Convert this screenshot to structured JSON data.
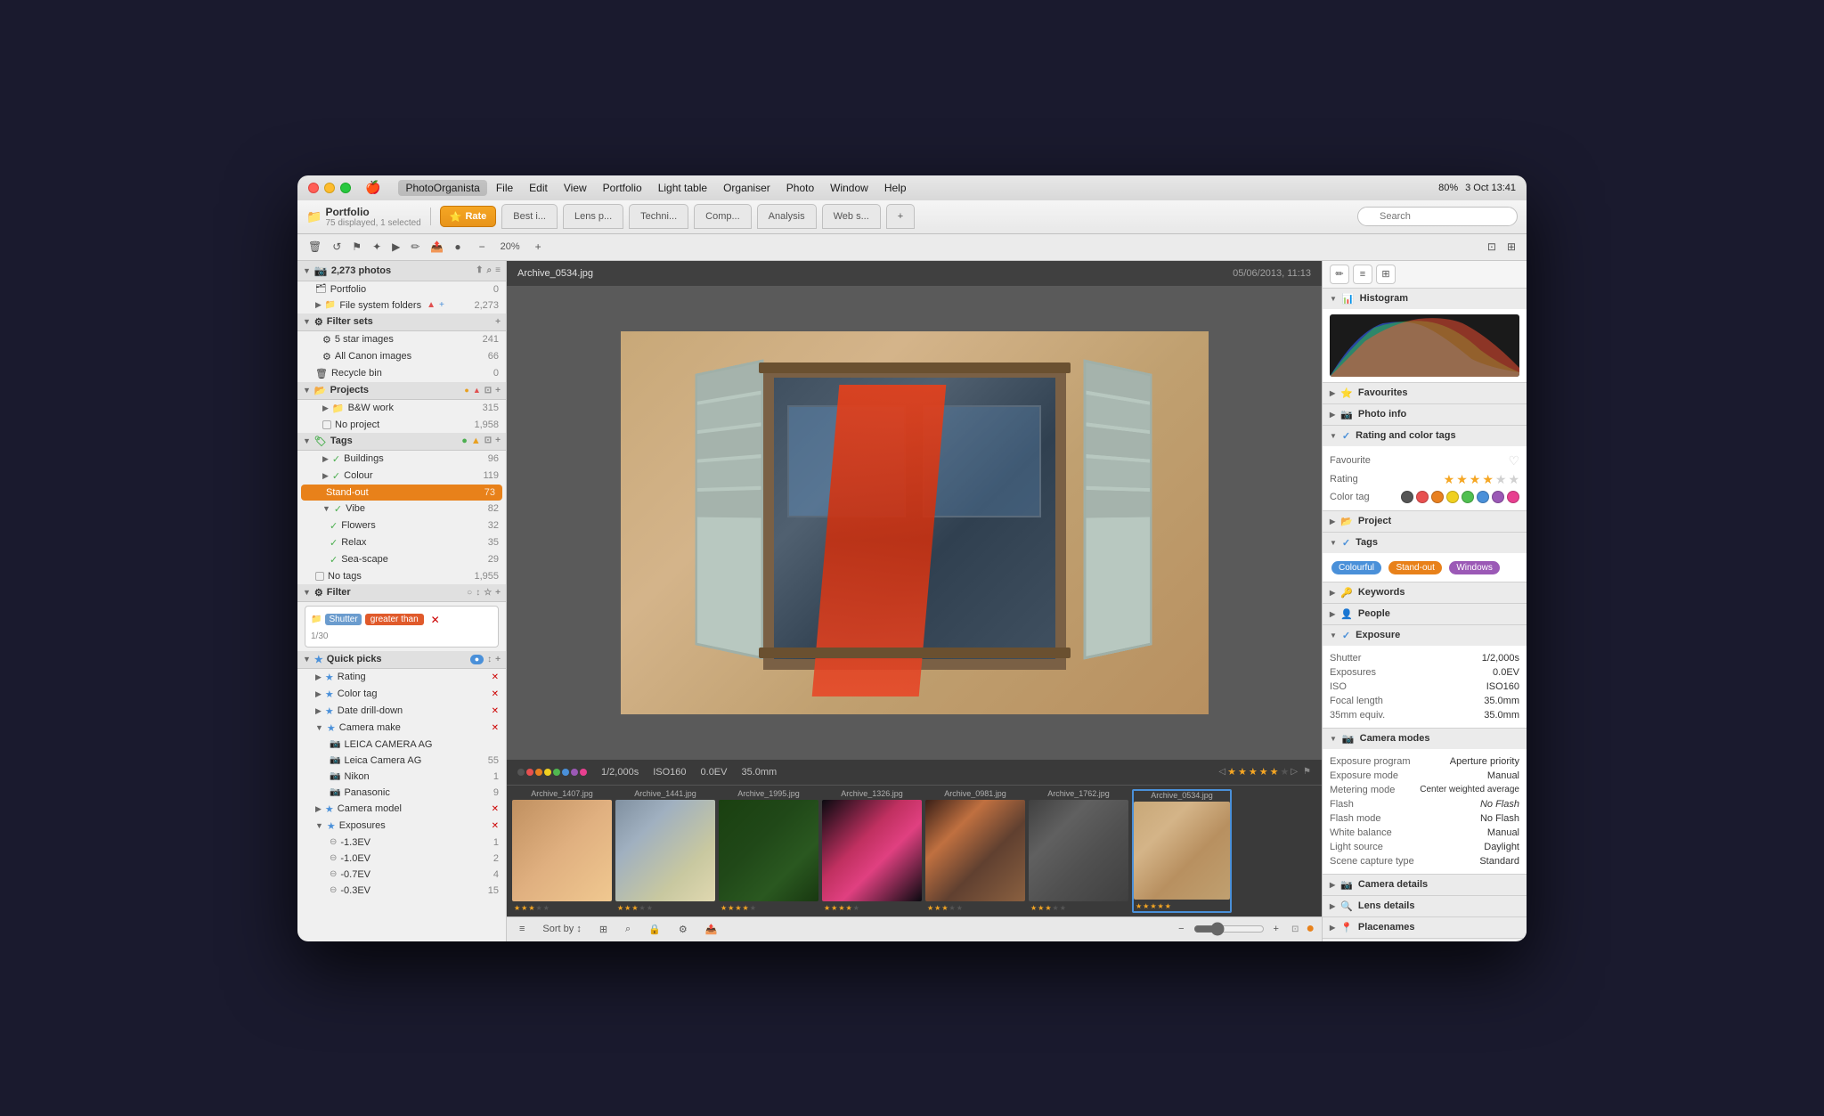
{
  "app": {
    "name": "PhotoOrganista",
    "date": "3 Oct",
    "time": "13:41",
    "battery": "80%"
  },
  "menu": {
    "apple": "🍎",
    "items": [
      "PhotoOrganista",
      "File",
      "Edit",
      "View",
      "Portfolio",
      "Light table",
      "Organiser",
      "Photo",
      "Window",
      "Help"
    ]
  },
  "toolbar": {
    "portfolio_label": "Portfolio",
    "portfolio_subtitle": "75 displayed, 1 selected",
    "tabs": [
      {
        "label": "Rate",
        "active": true,
        "icon": "⭐"
      },
      {
        "label": "Best i...",
        "active": false
      },
      {
        "label": "Lens p...",
        "active": false
      },
      {
        "label": "Techni...",
        "active": false
      },
      {
        "label": "Comp...",
        "active": false
      },
      {
        "label": "Analysis",
        "active": false
      },
      {
        "label": "Web s...",
        "active": false
      }
    ],
    "zoom_percent": "20%",
    "search_placeholder": "Search"
  },
  "sidebar": {
    "photos_count": "2,273 photos",
    "portfolio": {
      "label": "Portfolio",
      "count": "0"
    },
    "file_system": {
      "label": "File system folders",
      "count": "2,273"
    },
    "filter_sets": {
      "label": "Filter sets",
      "items": [
        {
          "label": "5 star images",
          "count": "241"
        },
        {
          "label": "All Canon images",
          "count": "66"
        }
      ]
    },
    "recycle_bin": {
      "label": "Recycle bin",
      "count": "0"
    },
    "projects": {
      "label": "Projects",
      "items": [
        {
          "label": "B&W work",
          "count": "315"
        },
        {
          "label": "No project",
          "count": "1,958"
        }
      ]
    },
    "tags": {
      "label": "Tags",
      "items": [
        {
          "label": "Buildings",
          "count": "96"
        },
        {
          "label": "Colour",
          "count": "119"
        },
        {
          "label": "Stand-out",
          "count": "73",
          "active": true
        },
        {
          "label": "Vibe",
          "count": "82"
        },
        {
          "label": "Flowers",
          "count": "32"
        },
        {
          "label": "Relax",
          "count": "35"
        },
        {
          "label": "Sea-scape",
          "count": "29"
        },
        {
          "label": "No tags",
          "count": "1,955"
        }
      ]
    },
    "filter": {
      "label": "Filter",
      "type": "Shutter",
      "condition": "greater than",
      "value": "1/30"
    },
    "quick_picks": {
      "label": "Quick picks",
      "items": [
        "Rating",
        "Color tag",
        "Date drill-down",
        "Camera make",
        "Camera model",
        "Exposures"
      ],
      "camera_makes": [
        {
          "label": "LEICA CAMERA AG",
          "count": ""
        },
        {
          "label": "Leica Camera AG",
          "count": "55"
        },
        {
          "label": "Nikon",
          "count": "1"
        },
        {
          "label": "Panasonic",
          "count": "9"
        }
      ]
    },
    "exposures": [
      {
        "label": "-1.3EV",
        "count": "1"
      },
      {
        "label": "-1.0EV",
        "count": "2"
      },
      {
        "label": "-0.7EV",
        "count": "4"
      },
      {
        "label": "-0.3EV",
        "count": "15"
      }
    ]
  },
  "main_photo": {
    "filename": "Archive_0534.jpg",
    "date": "05/06/2013, 11:13",
    "shutter": "1/2,000s",
    "iso": "ISO160",
    "ev": "0.0EV",
    "focal": "35.0mm"
  },
  "thumbnails": [
    {
      "filename": "Archive_1407.jpg",
      "stars": 3,
      "color": "arch1407"
    },
    {
      "filename": "Archive_1441.jpg",
      "stars": 3,
      "color": "arch1441"
    },
    {
      "filename": "Archive_1995.jpg",
      "stars": 4,
      "color": "arch1995"
    },
    {
      "filename": "Archive_1326.jpg",
      "stars": 4,
      "color": "arch1326"
    },
    {
      "filename": "Archive_0981.jpg",
      "stars": 3,
      "color": "arch0981"
    },
    {
      "filename": "Archive_1762.jpg",
      "stars": 3,
      "color": "arch1762"
    },
    {
      "filename": "Archive_0534.jpg",
      "stars": 5,
      "color": "arch0534"
    }
  ],
  "right_panel": {
    "histogram_label": "Histogram",
    "favourites_label": "Favourites",
    "photo_info_label": "Photo info",
    "rating_color_tags_label": "Rating and color tags",
    "favourite_label": "Favourite",
    "rating_label": "Rating",
    "rating_stars": 4,
    "color_tag_label": "Color tag",
    "project_label": "Project",
    "tags_label": "Tags",
    "tag_items": [
      "Colourful",
      "Stand-out",
      "Windows"
    ],
    "keywords_label": "Keywords",
    "people_label": "People",
    "exposure_label": "Exposure",
    "shutter_label": "Shutter",
    "shutter_value": "1/2,000s",
    "exposures_label": "Exposures",
    "exposures_value": "0.0EV",
    "iso_label": "ISO",
    "iso_value": "ISO160",
    "focal_label": "Focal length",
    "focal_value": "35.0mm",
    "equiv_label": "35mm equiv.",
    "equiv_value": "35.0mm",
    "camera_modes_label": "Camera modes",
    "exposure_program_label": "Exposure program",
    "exposure_program_value": "Aperture priority",
    "exposure_mode_label": "Exposure mode",
    "exposure_mode_value": "Manual",
    "metering_label": "Metering mode",
    "metering_value": "Center weighted average",
    "flash_label": "Flash",
    "flash_value": "No Flash",
    "flash_mode_label": "Flash mode",
    "flash_mode_value": "No Flash",
    "white_balance_label": "White balance",
    "white_balance_value": "Manual",
    "light_source_label": "Light source",
    "light_source_value": "Daylight",
    "scene_capture_label": "Scene capture type",
    "scene_capture_value": "Standard",
    "camera_details_label": "Camera details",
    "lens_details_label": "Lens details",
    "placenames_label": "Placenames"
  }
}
